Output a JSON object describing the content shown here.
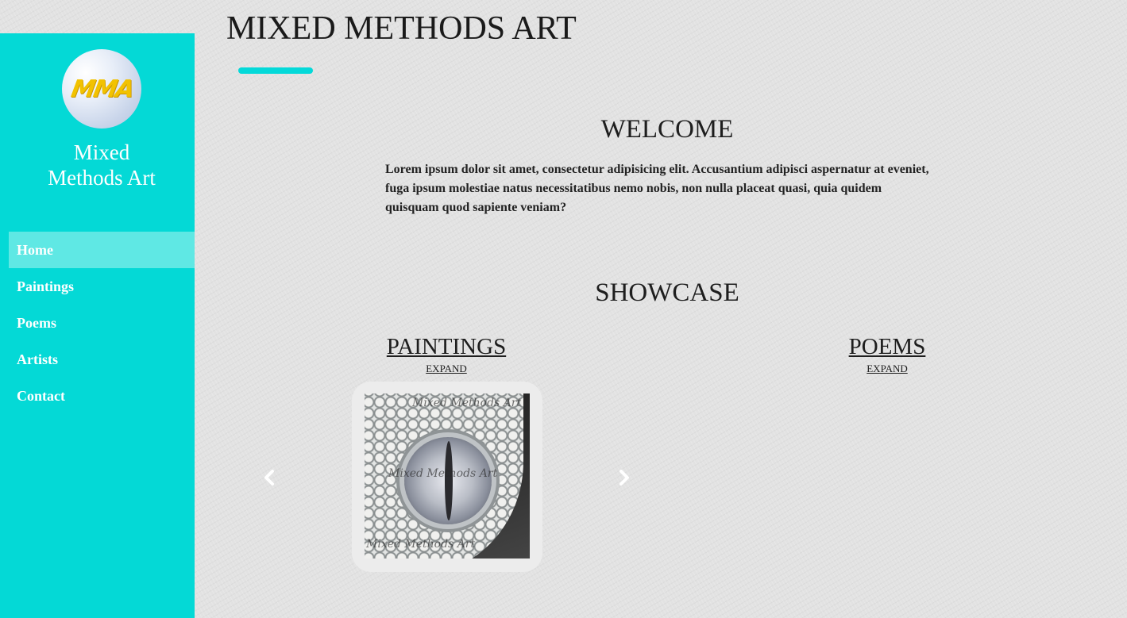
{
  "header": {
    "title": "MIXED METHODS ART"
  },
  "sidebar": {
    "logo_text": "MMA",
    "brand_line1": "Mixed",
    "brand_line2": "Methods Art",
    "items": [
      {
        "label": "Home",
        "active": true
      },
      {
        "label": "Paintings",
        "active": false
      },
      {
        "label": "Poems",
        "active": false
      },
      {
        "label": "Artists",
        "active": false
      },
      {
        "label": "Contact",
        "active": false
      }
    ]
  },
  "welcome": {
    "heading": "WELCOME",
    "text": "Lorem ipsum dolor sit amet, consectetur adipisicing elit. Accusantium adipisci aspernatur at eveniet, fuga ipsum molestiae natus necessitatibus nemo nobis, non nulla placeat quasi, quia quidem quisquam quod sapiente veniam?"
  },
  "showcase": {
    "heading": "SHOWCASE",
    "paintings": {
      "title": "PAINTINGS",
      "expand": "EXPAND",
      "watermark": "Mixed Methods Art"
    },
    "poems": {
      "title": "POEMS",
      "expand": "EXPAND"
    }
  },
  "colors": {
    "accent": "#04d9d6",
    "active_nav": "#5fe8e4",
    "background": "#e2e2e2"
  },
  "icons": {
    "prev": "chevron-left-icon",
    "next": "chevron-right-icon"
  }
}
